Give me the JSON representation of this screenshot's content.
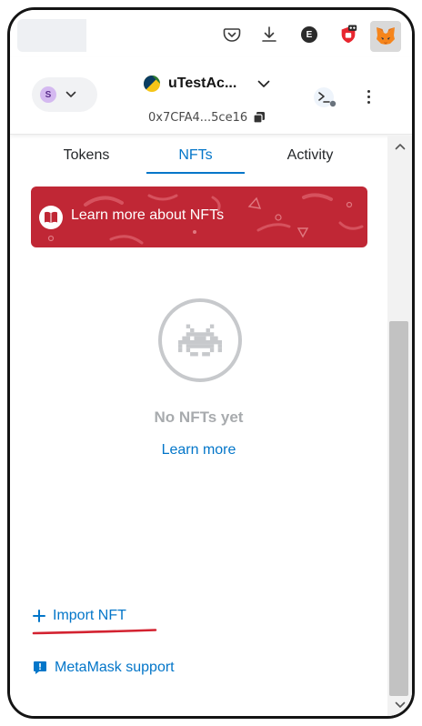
{
  "browser": {
    "extension_badge_letter": "E"
  },
  "header": {
    "network_avatar_letter": "S",
    "account_name": "uTestAc...",
    "address": "0x7CFA4...5ce16"
  },
  "tabs": [
    {
      "label": "Tokens",
      "active": false
    },
    {
      "label": "NFTs",
      "active": true
    },
    {
      "label": "Activity",
      "active": false
    }
  ],
  "banner": {
    "text": "Learn more about NFTs"
  },
  "empty_state": {
    "title": "No NFTs yet",
    "link": "Learn more"
  },
  "actions": {
    "import_nft": "Import NFT",
    "support": "MetaMask support"
  },
  "colors": {
    "accent": "#0376c9",
    "banner": "#c02735",
    "muted": "#a8abae"
  }
}
